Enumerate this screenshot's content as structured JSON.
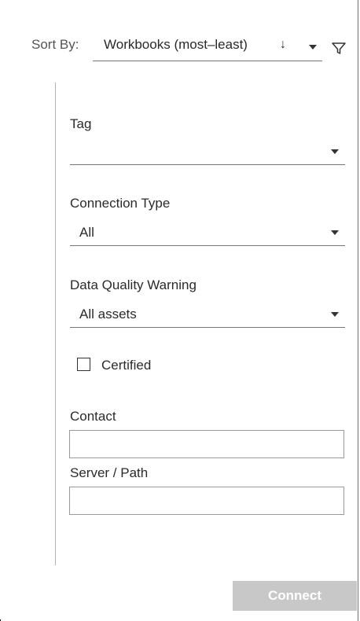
{
  "sort": {
    "label": "Sort By:",
    "selected": "Workbooks (most–least)",
    "direction_icon": "arrow-down-icon",
    "filter_icon": "filter-funnel-icon"
  },
  "filters": {
    "tag": {
      "label": "Tag",
      "value": ""
    },
    "connection_type": {
      "label": "Connection Type",
      "value": "All"
    },
    "data_quality_warning": {
      "label": "Data Quality Warning",
      "value": "All assets"
    },
    "certified": {
      "label": "Certified",
      "checked": false
    },
    "contact": {
      "label": "Contact",
      "value": ""
    },
    "server_path": {
      "label": "Server / Path",
      "value": ""
    }
  },
  "actions": {
    "connect_label": "Connect"
  },
  "colors": {
    "connect_disabled_bg": "#c8c8c8",
    "divider": "#b5b5b5",
    "text": "#2b2b2b"
  }
}
